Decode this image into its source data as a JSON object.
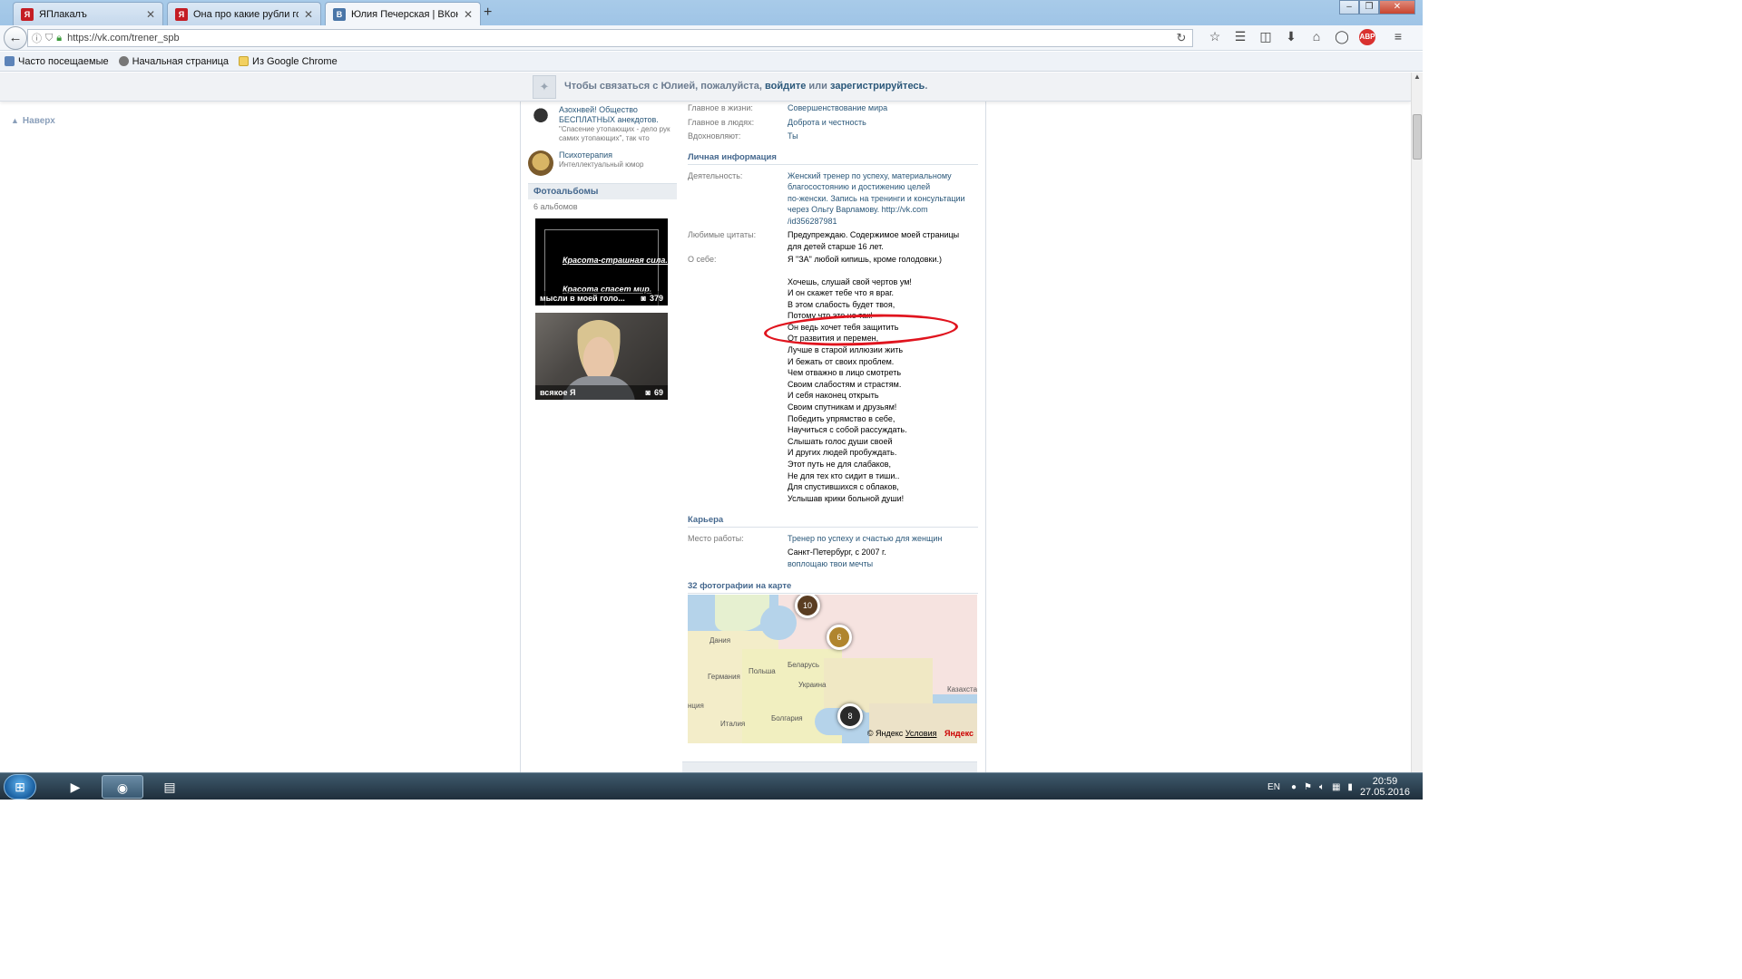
{
  "browser": {
    "tabs": [
      {
        "title": "ЯПлакалъ",
        "favicon": "yaplakal-icon",
        "active": false
      },
      {
        "title": "Она про какие рубли гов...",
        "favicon": "yaplakal-icon",
        "active": false
      },
      {
        "title": "Юлия Печерская | ВКонта...",
        "favicon": "vk-icon",
        "active": true
      }
    ],
    "new_tab": "+",
    "url": "https://vk.com/trener_spb",
    "bookmarks": [
      "Часто посещаемые",
      "Начальная страница",
      "Из Google Chrome"
    ],
    "abp_label": "ABP"
  },
  "page": {
    "banner": {
      "prefix": "Чтобы связаться с Юлией, пожалуйста,",
      "login": "войдите",
      "or": "или",
      "register": "зарегистрируйтесь",
      "suffix": "."
    },
    "to_top": "Наверх",
    "groups": [
      {
        "name": "Азохнвей! Общество БЕСПЛАТНЫХ анекдотов.",
        "desc": "\"Спасение утопающих - дело рук самих утопающих\", так что"
      },
      {
        "name": "Психотерапия",
        "desc": "Интеллектуальный юмор"
      }
    ],
    "albums_title": "Фотоальбомы",
    "albums_count": "6 альбомов",
    "albums": [
      {
        "quote": "Красота-страшная сила.",
        "quote2": "Красота спасет мир.",
        "name": "мысли в моей голо...",
        "count": "379"
      },
      {
        "name": "всякое Я",
        "count": "69"
      }
    ],
    "info": {
      "main_life_label": "Главное в жизни:",
      "main_life": "Совершенствование мира",
      "main_people_label": "Главное в людях:",
      "main_people": "Доброта и честность",
      "inspire_label": "Вдохновляют:",
      "inspire": "Ты",
      "personal_title": "Личная информация",
      "activity_label": "Деятельность:",
      "activity_lines": [
        "Женский тренер по успеху, материальному",
        "благосостоянию и достижению целей",
        "по-женски. Запись на тренинги и консультации",
        "через Ольгу Варламову. http://vk.com",
        "/id356287981"
      ],
      "quotes_label": "Любимые цитаты:",
      "quotes_lines": [
        "Предупреждаю. Содержимое моей страницы",
        "для детей старше 16 лет."
      ],
      "about_label": "О себе:",
      "about_first": "Я \"ЗА\" любой кипишь, кроме голодовки.)",
      "poem": [
        "Хочешь, слушай свой чертов ум!",
        "И он скажет тебе что я враг.",
        "В этом слабость будет твоя,",
        "Потому что это не так!",
        "Он ведь хочет тебя защитить",
        "От развития и перемен,",
        "Лучше в старой иллюзии жить",
        "И бежать от своих проблем.",
        "Чем отважно в лицо смотреть",
        "Своим слабостям и страстям.",
        "И себя наконец открыть",
        "Своим спутникам и друзьям!",
        "Победить упрямство в себе,",
        "Научиться с собой рассуждать.",
        "Слышать голос души своей",
        "И других людей пробуждать.",
        "Этот путь не для слабаков,",
        "Не для тех кто сидит в тиши..",
        "Для спустившихся с облаков,",
        "Услышав крики больной души!"
      ],
      "career_title": "Карьера",
      "work_label": "Место работы:",
      "work": "Тренер по успеху и счастью для женщин",
      "work_place": "Санкт-Петербург, с 2007 г.",
      "work_motto": "воплощаю твои мечты",
      "map_title": "32 фотографии на карте"
    },
    "map": {
      "labels": [
        "Дания",
        "Польша",
        "Беларусь",
        "Германия",
        "Украина",
        "Казахста",
        "нция",
        "Италия",
        "Болгария"
      ],
      "clusters": [
        "10",
        "6",
        "8"
      ],
      "credit": "© Яндекс",
      "terms": "Условия",
      "brand": "Яндекс"
    }
  },
  "taskbar": {
    "lang": "EN",
    "time": "20:59",
    "date": "27.05.2016"
  }
}
